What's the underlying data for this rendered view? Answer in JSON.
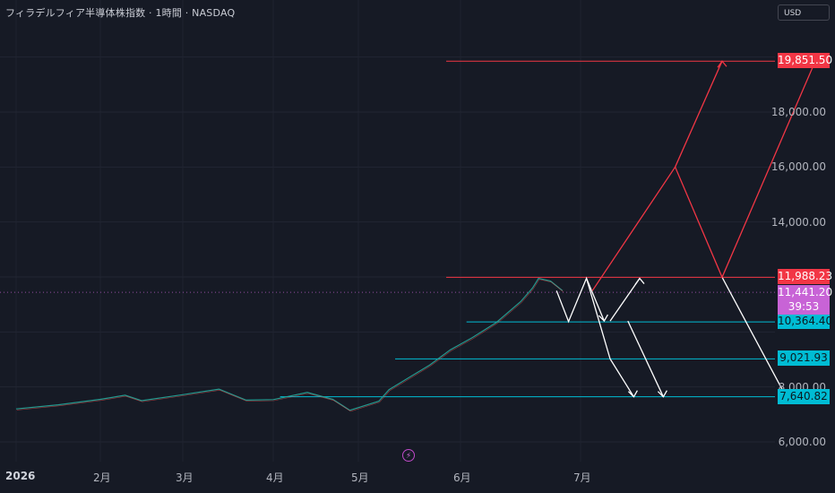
{
  "header": {
    "title": "フィラデルフィア半導体株指数 · 1時間 · NASDAQ",
    "currency": "USD"
  },
  "colors": {
    "background": "#161a25",
    "red": "#f23645",
    "cyan": "#00bcd4",
    "purple": "#c863d6",
    "white": "#ffffff"
  },
  "chart_data": {
    "type": "line",
    "ylim": [
      5500,
      20300
    ],
    "y_ticks": [
      "18,000.00",
      "16,000.00",
      "14,000.00",
      "8,000.00",
      "6,000.00"
    ],
    "y_tick_values": [
      18000,
      16000,
      14000,
      8000,
      6000
    ],
    "x_ticks": [
      "2026",
      "2月",
      "3月",
      "4月",
      "5月",
      "6月",
      "7月"
    ],
    "grid": true,
    "price_series": [
      [
        0,
        7200
      ],
      [
        0.5,
        7350
      ],
      [
        1,
        7550
      ],
      [
        1.3,
        7700
      ],
      [
        1.5,
        7500
      ],
      [
        2,
        7720
      ],
      [
        2.4,
        7920
      ],
      [
        2.7,
        7520
      ],
      [
        3,
        7540
      ],
      [
        3.4,
        7800
      ],
      [
        3.7,
        7550
      ],
      [
        3.9,
        7150
      ],
      [
        4.2,
        7480
      ],
      [
        4.3,
        7900
      ],
      [
        4.5,
        8350
      ],
      [
        4.7,
        8800
      ],
      [
        4.9,
        9350
      ],
      [
        5.1,
        9800
      ],
      [
        5.3,
        10350
      ],
      [
        5.5,
        11100
      ],
      [
        5.6,
        11600
      ],
      [
        5.65,
        11950
      ],
      [
        5.75,
        11850
      ],
      [
        5.85,
        11500
      ]
    ],
    "horizontal_levels": [
      {
        "price": 19851.5,
        "label": "19,851.50",
        "color": "red"
      },
      {
        "price": 11988.23,
        "label": "11,988.23",
        "color": "red"
      },
      {
        "price": 10364.4,
        "label": "10,364.40",
        "color": "cyan"
      },
      {
        "price": 9021.93,
        "label": "9,021.93",
        "color": "cyan"
      },
      {
        "price": 7640.82,
        "label": "7,640.82",
        "color": "cyan"
      }
    ],
    "last_price": {
      "label": "11,441.20",
      "countdown": "39:53"
    },
    "projection_paths": [
      {
        "color": "white",
        "points": [
          [
            5.8,
            11500
          ],
          [
            5.9,
            10380
          ],
          [
            6.05,
            11950
          ],
          [
            6.25,
            9020
          ],
          [
            6.45,
            7640
          ]
        ]
      },
      {
        "color": "white",
        "points": [
          [
            6.05,
            11950
          ],
          [
            6.2,
            10400
          ]
        ]
      },
      {
        "color": "white",
        "points": [
          [
            6.25,
            10400
          ],
          [
            6.5,
            11950
          ]
        ]
      },
      {
        "color": "white",
        "points": [
          [
            6.4,
            10400
          ],
          [
            6.7,
            7640
          ]
        ]
      },
      {
        "color": "white",
        "points": [
          [
            7.2,
            11990
          ],
          [
            7.75,
            7640
          ]
        ]
      },
      {
        "color": "red",
        "points": [
          [
            6.1,
            11500
          ],
          [
            6.8,
            16000
          ],
          [
            7.2,
            11990
          ],
          [
            8.15,
            19851
          ]
        ]
      },
      {
        "color": "red",
        "points": [
          [
            6.8,
            16000
          ],
          [
            7.2,
            19851
          ]
        ]
      }
    ],
    "projection_arrows": [
      {
        "color": "white",
        "at": [
          6.45,
          7640
        ]
      },
      {
        "color": "white",
        "at": [
          6.2,
          10400
        ]
      },
      {
        "color": "white",
        "at": [
          6.5,
          11950
        ]
      },
      {
        "color": "white",
        "at": [
          6.7,
          7640
        ]
      },
      {
        "color": "white",
        "at": [
          7.75,
          7640
        ]
      },
      {
        "color": "red",
        "at": [
          7.2,
          19851
        ]
      },
      {
        "color": "red",
        "at": [
          8.15,
          19851
        ]
      }
    ]
  }
}
